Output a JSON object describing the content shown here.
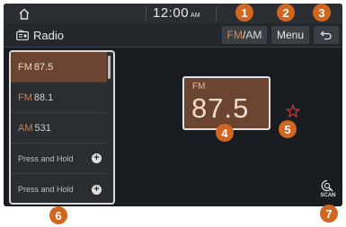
{
  "status": {
    "time": "12:00",
    "ampm": "AM"
  },
  "header": {
    "title": "Radio",
    "band_fm": "FM",
    "band_sep": "/",
    "band_am": "AM",
    "menu_label": "Menu"
  },
  "presets": [
    {
      "band": "FM",
      "freq": "87.5",
      "selected": true
    },
    {
      "band": "FM",
      "freq": "88.1",
      "selected": false
    },
    {
      "band": "AM",
      "freq": "531",
      "selected": false
    },
    {
      "label": "Press and Hold",
      "empty": true
    },
    {
      "label": "Press and Hold",
      "empty": true
    }
  ],
  "station": {
    "band": "FM",
    "freq": "87.5"
  },
  "scan_label": "SCAN",
  "callouts": [
    "1",
    "2",
    "3",
    "4",
    "5",
    "6",
    "7"
  ],
  "colors": {
    "accent": "#d58a56",
    "callout": "#d0661f",
    "selected_bg": "#6b4532"
  }
}
